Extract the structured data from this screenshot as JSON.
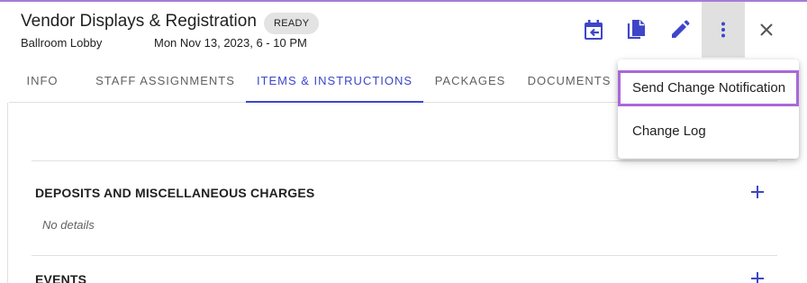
{
  "header": {
    "title": "Vendor Displays & Registration",
    "status": "READY",
    "location": "Ballroom Lobby",
    "datetime": "Mon Nov 13, 2023, 6 - 10 PM"
  },
  "toolbar": {
    "icons": [
      "calendar-import-icon",
      "copy-icon",
      "edit-icon",
      "more-vert-icon",
      "close-icon"
    ]
  },
  "tabs": [
    {
      "label": "INFO",
      "active": false
    },
    {
      "label": "STAFF ASSIGNMENTS",
      "active": false
    },
    {
      "label": "ITEMS & INSTRUCTIONS",
      "active": true
    },
    {
      "label": "PACKAGES",
      "active": false
    },
    {
      "label": "DOCUMENTS",
      "active": false
    }
  ],
  "sections": [
    {
      "title": "DEPOSITS AND MISCELLANEOUS CHARGES",
      "empty_text": "No details"
    },
    {
      "title": "EVENTS"
    }
  ],
  "menu": {
    "items": [
      {
        "label": "Send Change Notification",
        "highlighted": true
      },
      {
        "label": "Change Log",
        "highlighted": false
      }
    ]
  },
  "colors": {
    "accent": "#3e46c8",
    "highlight_outline": "#a968d8",
    "chip_bg": "#e3e3e3"
  }
}
